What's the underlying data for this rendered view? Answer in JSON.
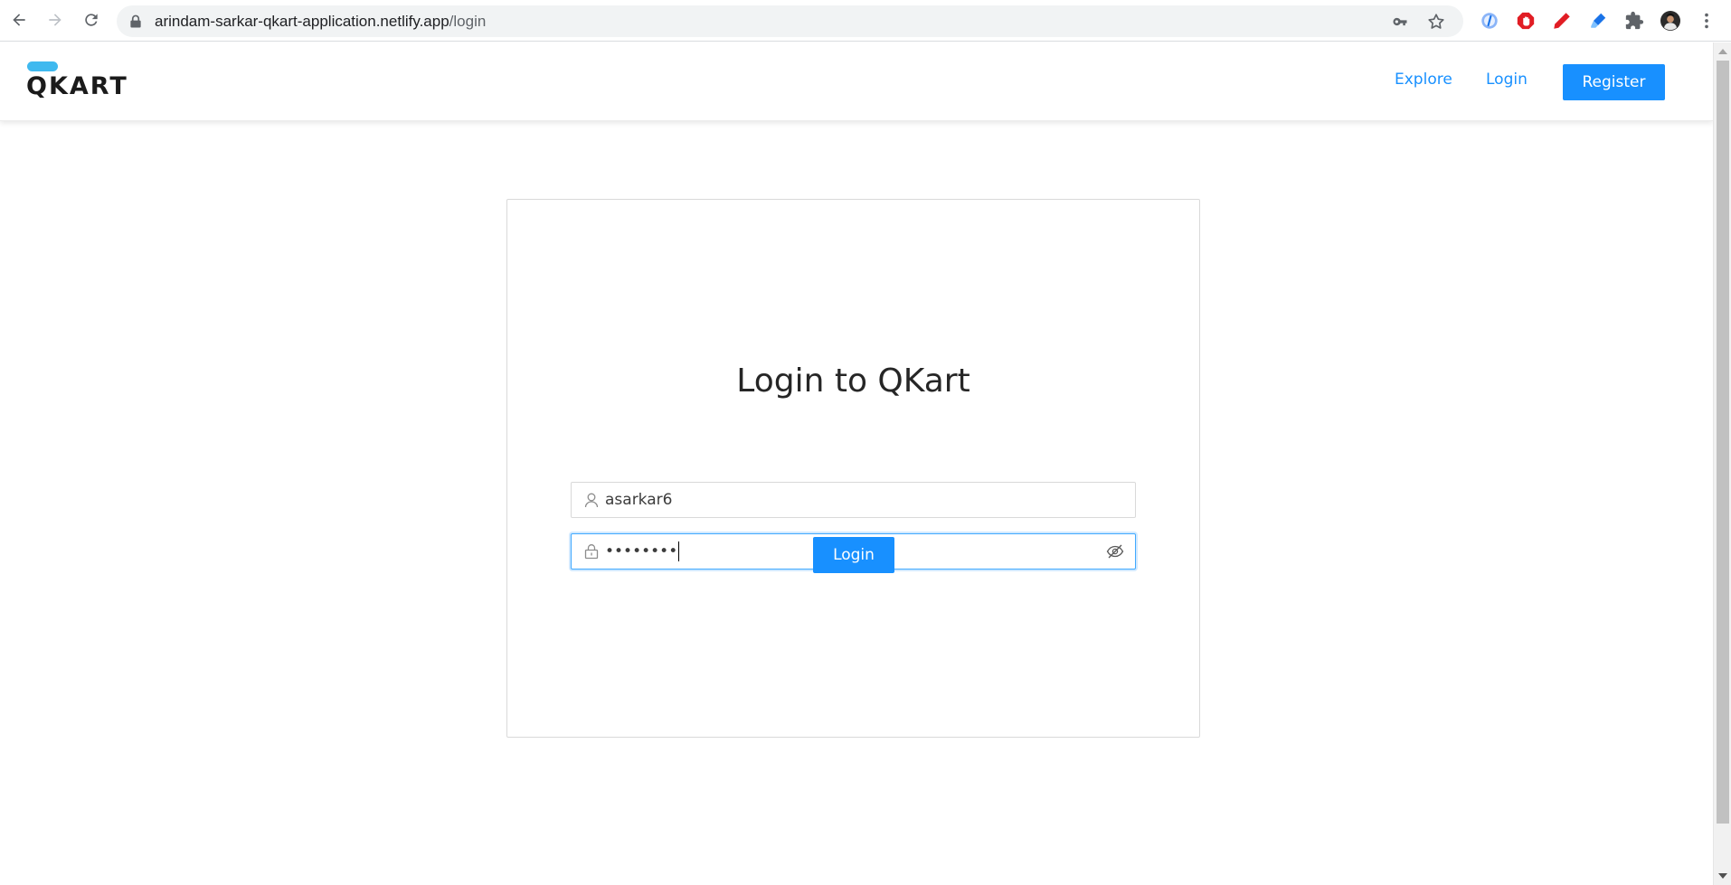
{
  "browser": {
    "url_host": "arindam-sarkar-qkart-application.netlify.app",
    "url_path": "/login",
    "nav": {
      "back_icon": "arrow-left-icon",
      "forward_icon": "arrow-right-icon",
      "reload_icon": "reload-icon"
    },
    "omnibox_icons": [
      "lock-icon",
      "key-icon",
      "star-icon"
    ],
    "extensions": [
      "compass-extension-icon",
      "adblock-extension-icon",
      "red-pen-extension-icon",
      "highlighter-extension-icon",
      "puzzle-icon",
      "profile-avatar",
      "more-vert-icon"
    ]
  },
  "header": {
    "logo_text": "QKART",
    "logo_accent": "#3fb9ef",
    "links": {
      "explore": "Explore",
      "login": "Login"
    },
    "register_label": "Register"
  },
  "login_card": {
    "title": "Login to QKart",
    "username": {
      "value": "asarkar6",
      "icon": "user-icon"
    },
    "password": {
      "masked_value": "••••••••",
      "icon": "lock-icon",
      "toggle_icon": "eye-invisible-icon"
    },
    "submit_label": "Login"
  },
  "colors": {
    "primary": "#1890ff",
    "focus_border": "#40a9ff",
    "text_dark": "#262626"
  }
}
